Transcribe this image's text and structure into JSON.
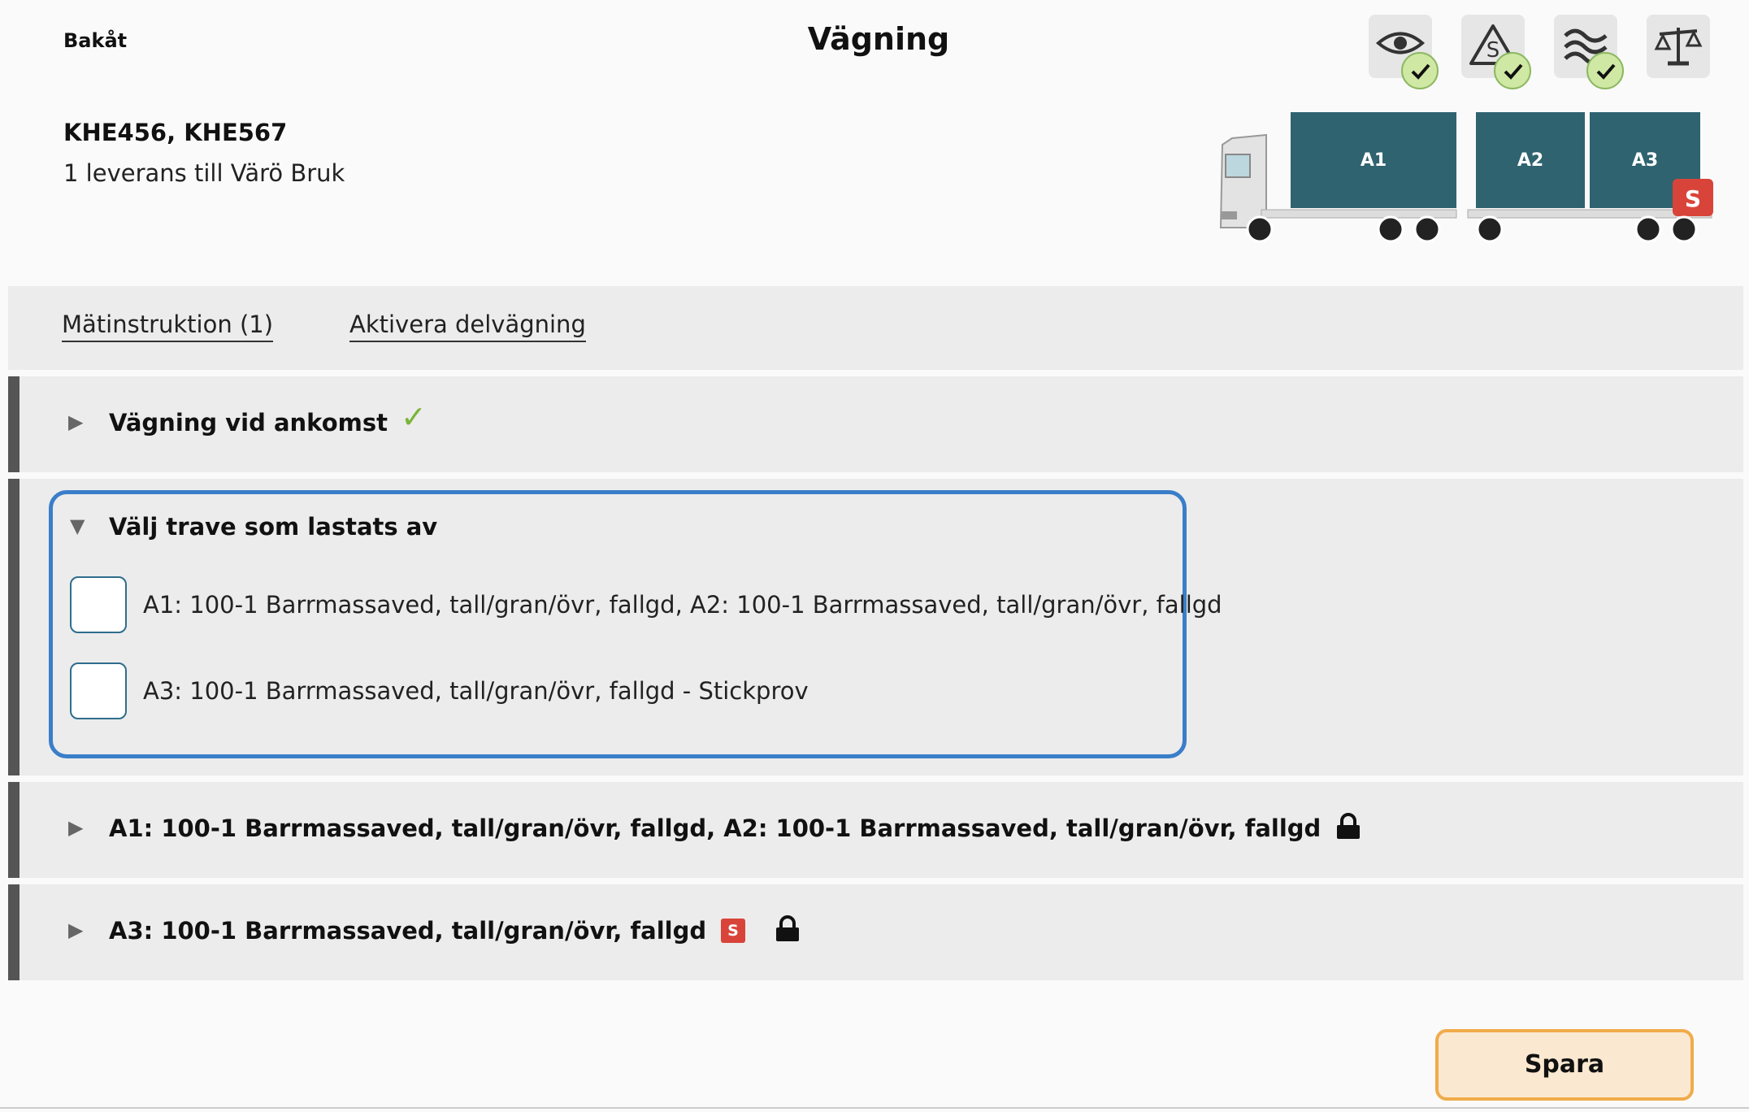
{
  "header": {
    "back_label": "Bakåt",
    "title": "Vägning",
    "vehicle_ids": "KHE456, KHE567",
    "delivery_info": "1 leverans till Värö Bruk"
  },
  "status_icons": [
    {
      "icon": "eye-icon",
      "checked": true
    },
    {
      "icon": "sample-warning-icon",
      "checked": true
    },
    {
      "icon": "moisture-waves-icon",
      "checked": true
    },
    {
      "icon": "scale-icon",
      "checked": false
    }
  ],
  "truck": {
    "blocks": [
      "A1",
      "A2",
      "A3"
    ],
    "sample_badge": "S",
    "block_color": "#2f6370"
  },
  "tabs": [
    {
      "label": "Mätinstruktion (1)"
    },
    {
      "label": "Aktivera delvägning"
    }
  ],
  "sections": {
    "arrival": {
      "title": "Vägning vid ankomst",
      "completed": true
    },
    "select_pile": {
      "title": "Välj trave som lastats av",
      "options": [
        {
          "label": "A1: 100-1 Barrmassaved, tall/gran/övr, fallgd, A2: 100-1 Barrmassaved, tall/gran/övr, fallgd",
          "checked": false
        },
        {
          "label": "A3: 100-1 Barrmassaved, tall/gran/övr, fallgd - Stickprov",
          "checked": false
        }
      ]
    },
    "load_a1a2": {
      "title": "A1: 100-1 Barrmassaved, tall/gran/övr, fallgd, A2: 100-1 Barrmassaved, tall/gran/övr, fallgd",
      "locked": true
    },
    "load_a3": {
      "title": "A3: 100-1 Barrmassaved, tall/gran/övr, fallgd",
      "badge": "S",
      "locked": true
    }
  },
  "footer": {
    "save_label": "Spara"
  },
  "colors": {
    "accent_border": "#3a7ec9",
    "save_border": "#f0ab4a",
    "save_bg": "#fbe8d1",
    "check_green": "#7ab53a",
    "sample_red": "#d9443a"
  }
}
